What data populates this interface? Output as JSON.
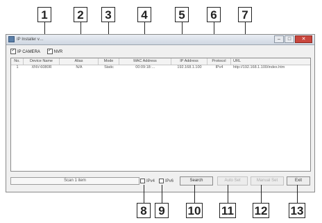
{
  "window": {
    "title": "IP Installer v…",
    "minimize": "–",
    "maximize": "□",
    "close": "✕"
  },
  "filters": {
    "ip_camera": "IP CAMERA",
    "nvr": "NVR",
    "check_mark": "✓"
  },
  "table": {
    "columns": [
      "No.",
      "Device Name",
      "Alias",
      "Mode",
      "MAC Address",
      "IP Address",
      "Protocol",
      "URL"
    ],
    "rows": [
      [
        "1",
        "XNV-6080R",
        "N/A",
        "Static",
        "00:09:18:…",
        "192.168.1.100",
        "IPv4",
        "http://192.168.1.100/index.htm"
      ]
    ]
  },
  "footer": {
    "status_text": "Scan 1 item",
    "ipv4_label": "IPv4",
    "ipv6_label": "IPv6",
    "search_label": "Search",
    "auto_set_label": "Auto Set",
    "manual_set_label": "Manual Set",
    "exit_label": "Exit"
  },
  "callouts": [
    "1",
    "2",
    "3",
    "4",
    "5",
    "6",
    "7",
    "8",
    "9",
    "10",
    "11",
    "12",
    "13"
  ]
}
